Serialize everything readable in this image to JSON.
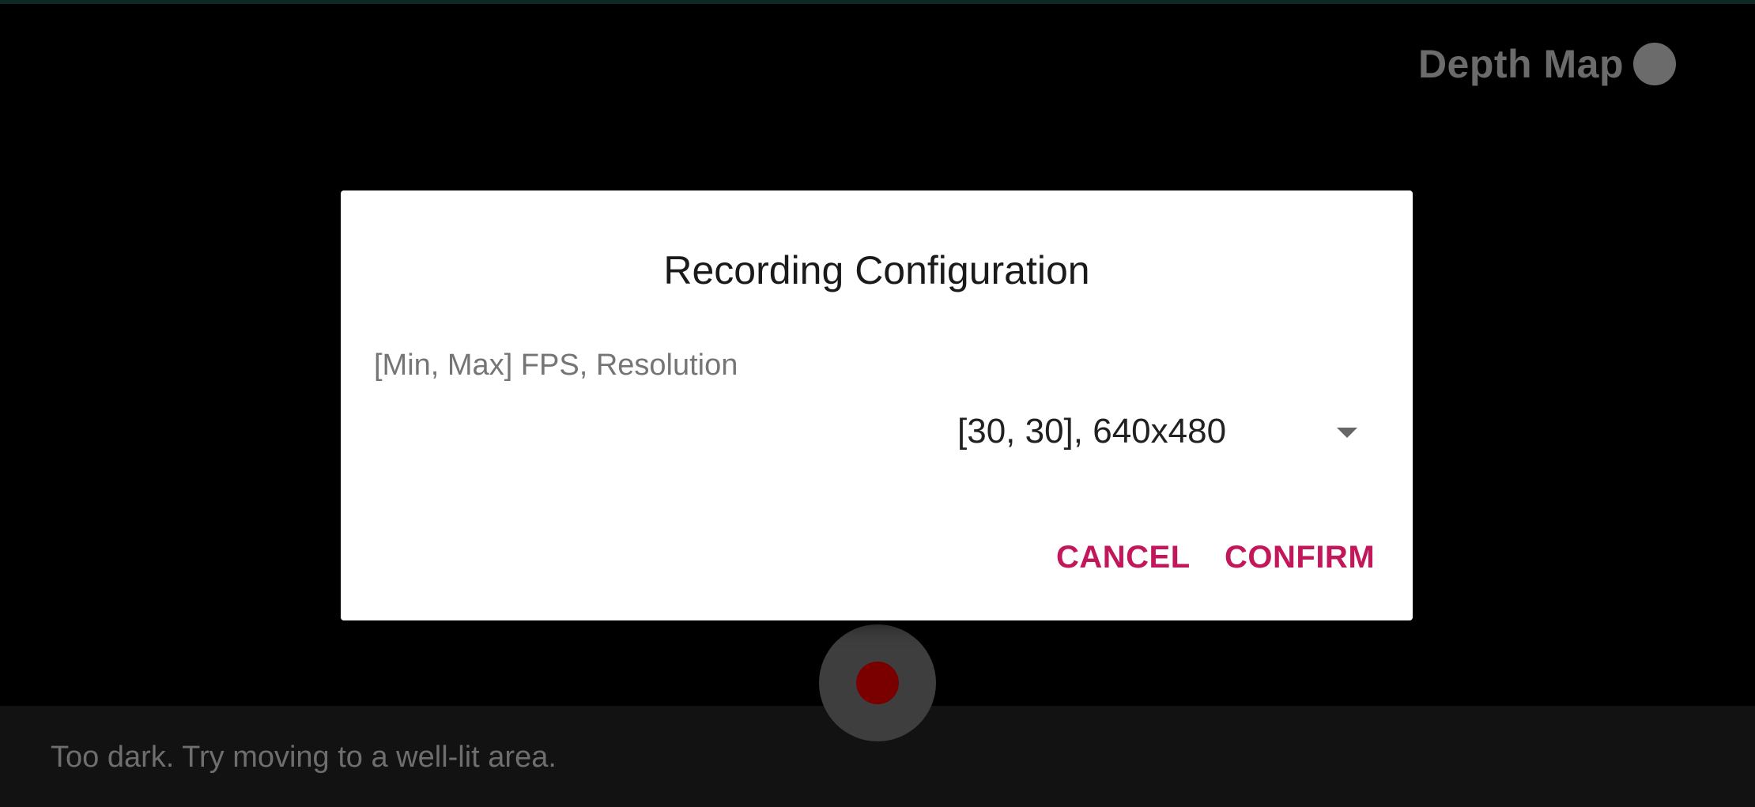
{
  "overlay": {
    "depth_map_label": "Depth Map"
  },
  "dialog": {
    "title": "Recording Configuration",
    "field_label": "[Min, Max] FPS, Resolution",
    "selected_value": "[30, 30], 640x480",
    "cancel_label": "CANCEL",
    "confirm_label": "CONFIRM"
  },
  "status": {
    "message": "Too dark. Try moving to a well-lit area."
  },
  "icons": {
    "dropdown": "chevron-down-icon",
    "record": "record-icon",
    "depth_toggle": "circle-toggle-icon"
  },
  "colors": {
    "accent": "#c2185b",
    "record": "#7a0000",
    "background": "#000000"
  }
}
